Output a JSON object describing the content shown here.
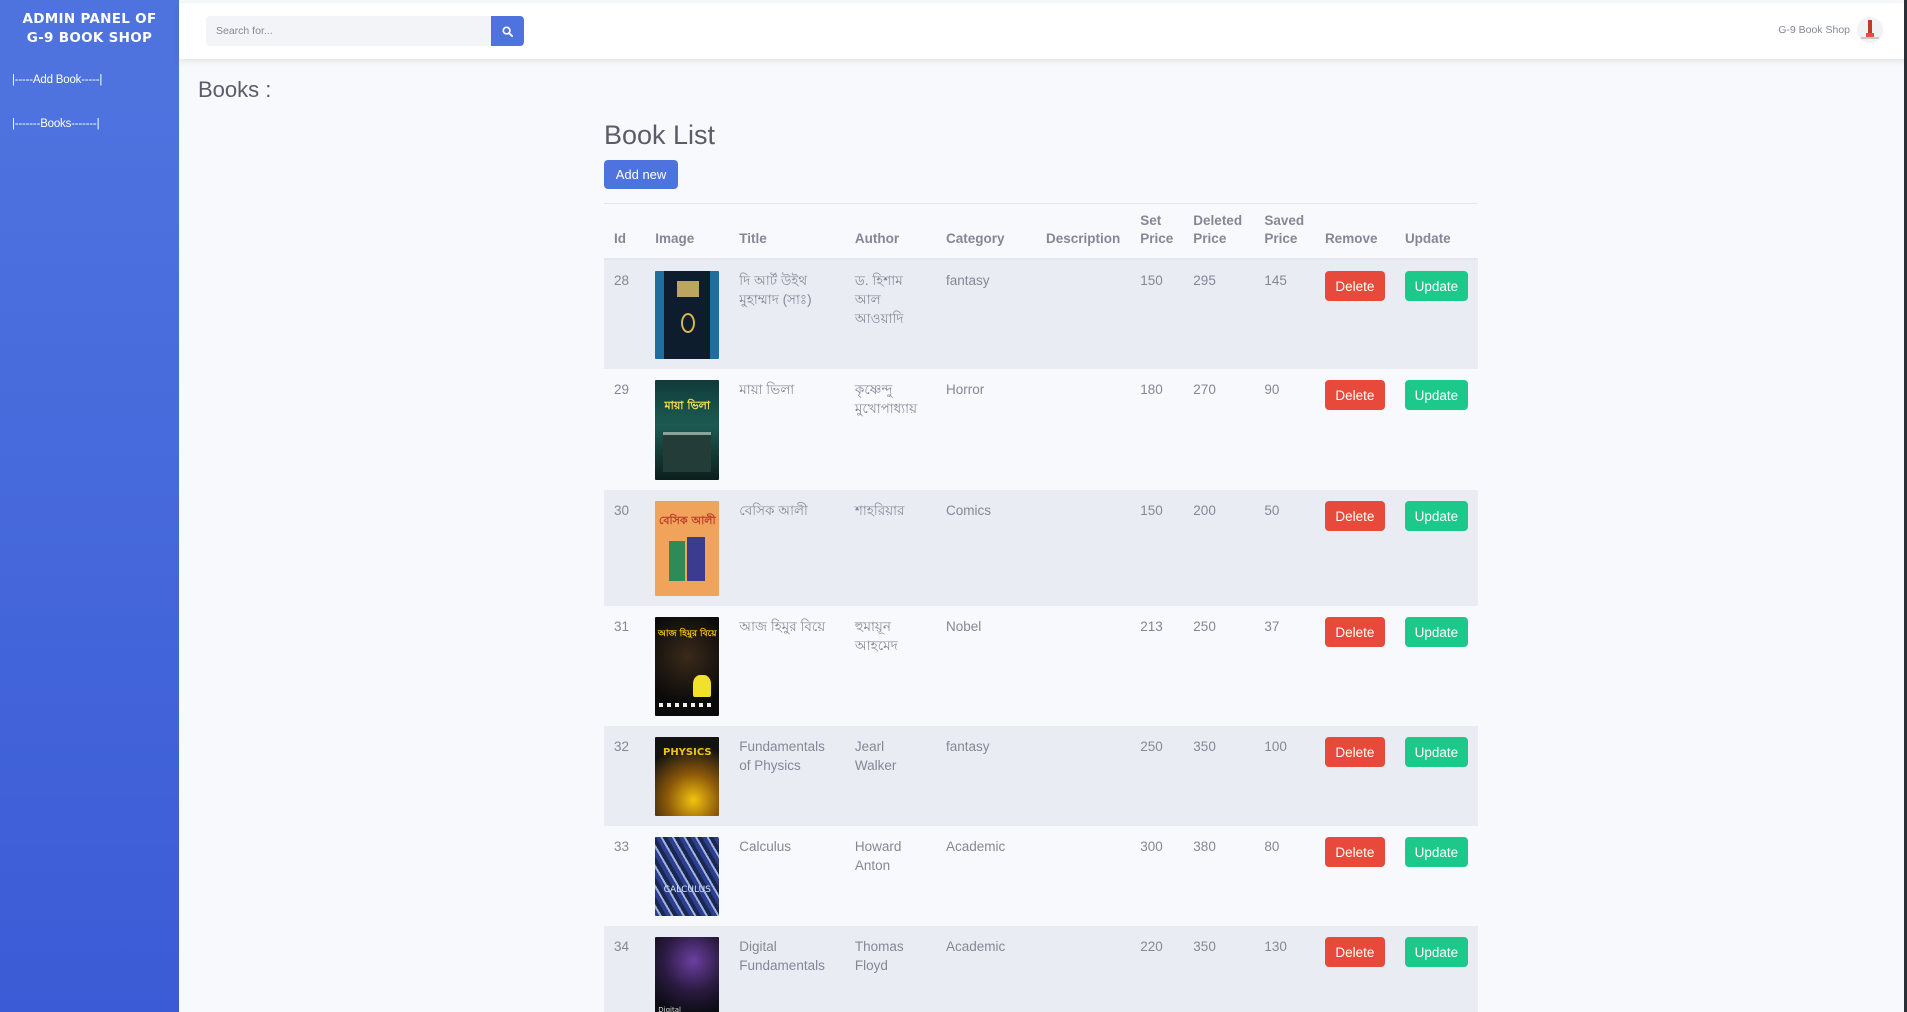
{
  "sidebar": {
    "brand_line1": "ADMIN PANEL OF",
    "brand_line2": "G-9 BOOK SHOP",
    "links": [
      {
        "label": "|-----Add Book-----|"
      },
      {
        "label": "|-------Books-------|"
      }
    ]
  },
  "topbar": {
    "search_placeholder": "Search for...",
    "search_icon": "search-icon",
    "user_name": "G-9 Book Shop"
  },
  "page": {
    "heading": "Books :",
    "list_title": "Book List",
    "add_button": "Add new"
  },
  "colors": {
    "primary": "#4e73df",
    "danger": "#e74a3b",
    "success": "#1cc88a",
    "row_alt": "#eaecf4"
  },
  "table": {
    "headers": {
      "id": "Id",
      "image": "Image",
      "title": "Title",
      "author": "Author",
      "category": "Category",
      "description": "Description",
      "set_price": "Set Price",
      "deleted_price": "Deleted Price",
      "saved_price": "Saved Price",
      "remove": "Remove",
      "update": "Update"
    },
    "rows": [
      {
        "id": "28",
        "title": "দি আর্ট উইথ মুহাম্মাদ (সাঃ)",
        "author": "ড. হিশাম আল আওয়াদি",
        "category": "fantasy",
        "description": "",
        "set_price": "150",
        "deleted_price": "295",
        "saved_price": "145",
        "delete_label": "Delete",
        "update_label": "Update"
      },
      {
        "id": "29",
        "title": "মায়া ভিলা",
        "author": "কৃষ্ণেন্দু মুখোপাধ্যায়",
        "category": "Horror",
        "description": "",
        "set_price": "180",
        "deleted_price": "270",
        "saved_price": "90",
        "delete_label": "Delete",
        "update_label": "Update"
      },
      {
        "id": "30",
        "title": "বেসিক আলী",
        "author": "শাহরিয়ার",
        "category": "Comics",
        "description": "",
        "set_price": "150",
        "deleted_price": "200",
        "saved_price": "50",
        "delete_label": "Delete",
        "update_label": "Update"
      },
      {
        "id": "31",
        "title": "আজ হিমুর বিয়ে",
        "author": "হুমায়ূন আহমেদ",
        "category": "Nobel",
        "description": "",
        "set_price": "213",
        "deleted_price": "250",
        "saved_price": "37",
        "delete_label": "Delete",
        "update_label": "Update"
      },
      {
        "id": "32",
        "title": "Fundamentals of Physics",
        "author": "Jearl Walker",
        "category": "fantasy",
        "description": "",
        "set_price": "250",
        "deleted_price": "350",
        "saved_price": "100",
        "delete_label": "Delete",
        "update_label": "Update"
      },
      {
        "id": "33",
        "title": "Calculus",
        "author": "Howard Anton",
        "category": "Academic",
        "description": "",
        "set_price": "300",
        "deleted_price": "380",
        "saved_price": "80",
        "delete_label": "Delete",
        "update_label": "Update"
      },
      {
        "id": "34",
        "title": "Digital Fundamentals",
        "author": "Thomas Floyd",
        "category": "Academic",
        "description": "",
        "set_price": "220",
        "deleted_price": "350",
        "saved_price": "130",
        "delete_label": "Delete",
        "update_label": "Update"
      }
    ]
  }
}
